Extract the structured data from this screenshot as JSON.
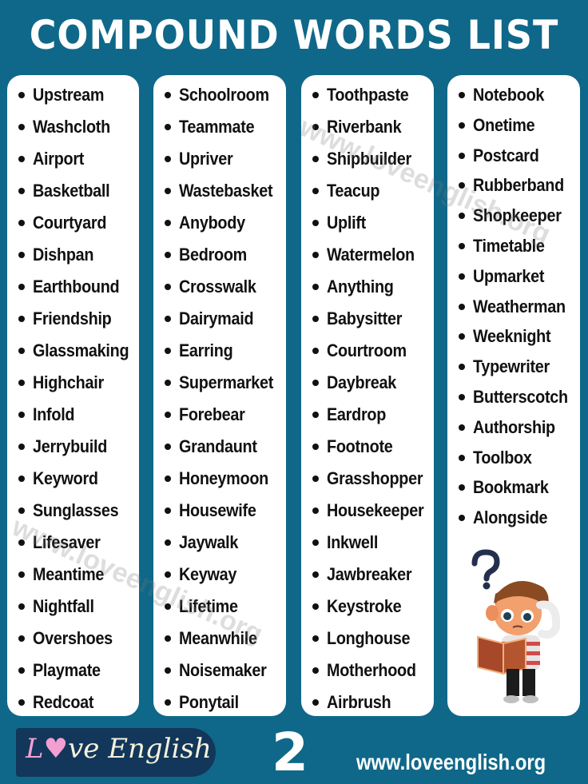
{
  "header": {
    "title": "COMPOUND WORDS LIST"
  },
  "columns": [
    {
      "words": [
        "Upstream",
        "Washcloth",
        "Airport",
        "Basketball",
        "Courtyard",
        "Dishpan",
        "Earthbound",
        "Friendship",
        "Glassmaking",
        "Highchair",
        "Infold",
        "Jerrybuild",
        "Keyword",
        "Sunglasses",
        "Lifesaver",
        "Meantime",
        "Nightfall",
        "Overshoes",
        "Playmate",
        "Redcoat"
      ]
    },
    {
      "words": [
        "Schoolroom",
        "Teammate",
        "Upriver",
        "Wastebasket",
        "Anybody",
        "Bedroom",
        "Crosswalk",
        "Dairymaid",
        "Earring",
        "Supermarket",
        "Forebear",
        "Grandaunt",
        "Honeymoon",
        "Housewife",
        "Jaywalk",
        "Keyway",
        "Lifetime",
        "Meanwhile",
        "Noisemaker",
        "Ponytail"
      ]
    },
    {
      "words": [
        "Toothpaste",
        "Riverbank",
        "Shipbuilder",
        "Teacup",
        "Uplift",
        "Watermelon",
        "Anything",
        "Babysitter",
        "Courtroom",
        "Daybreak",
        "Eardrop",
        "Footnote",
        "Grasshopper",
        "Housekeeper",
        "Inkwell",
        "Jawbreaker",
        "Keystroke",
        "Longhouse",
        "Motherhood",
        "Airbrush"
      ]
    },
    {
      "words": [
        "Notebook",
        "Onetime",
        "Postcard",
        "Rubberband",
        "Shopkeeper",
        "Timetable",
        "Upmarket",
        "Weatherman",
        "Weeknight",
        "Typewriter",
        "Butterscotch",
        "Authorship",
        "Toolbox",
        "Bookmark",
        "Alongside"
      ]
    }
  ],
  "watermark": "www.loveenglish.org",
  "footer": {
    "logo_l": "L",
    "logo_heart": "♥",
    "logo_rest": "ve English",
    "page_number": "2",
    "url": "www.loveenglish.org"
  },
  "colors": {
    "background": "#0f6889",
    "card": "#ffffff",
    "logo_bg": "#12375a",
    "logo_pink": "#f29fd1"
  }
}
